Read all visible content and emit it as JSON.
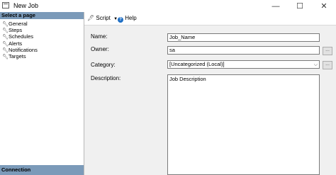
{
  "window": {
    "title": "New Job",
    "minimize_glyph": "—",
    "maximize_glyph": "☐",
    "close_glyph": "✕"
  },
  "sidebar": {
    "header": "Select a page",
    "items": [
      {
        "label": "General",
        "icon": "wrench-icon"
      },
      {
        "label": "Steps",
        "icon": "wrench-icon"
      },
      {
        "label": "Schedules",
        "icon": "wrench-icon"
      },
      {
        "label": "Alerts",
        "icon": "wrench-icon"
      },
      {
        "label": "Notifications",
        "icon": "wrench-icon"
      },
      {
        "label": "Targets",
        "icon": "wrench-icon"
      }
    ],
    "footer": "Connection",
    "header_color": "#7b9ab9"
  },
  "toolbar": {
    "script_label": "Script",
    "help_label": "Help"
  },
  "form": {
    "name_label": "Name:",
    "name_value": "Job_Name",
    "owner_label": "Owner:",
    "owner_value": "sa",
    "category_label": "Category:",
    "category_value": "[Uncategorized (Local)]",
    "description_label": "Description:",
    "description_value": "Job Description",
    "browse_label": "..."
  }
}
